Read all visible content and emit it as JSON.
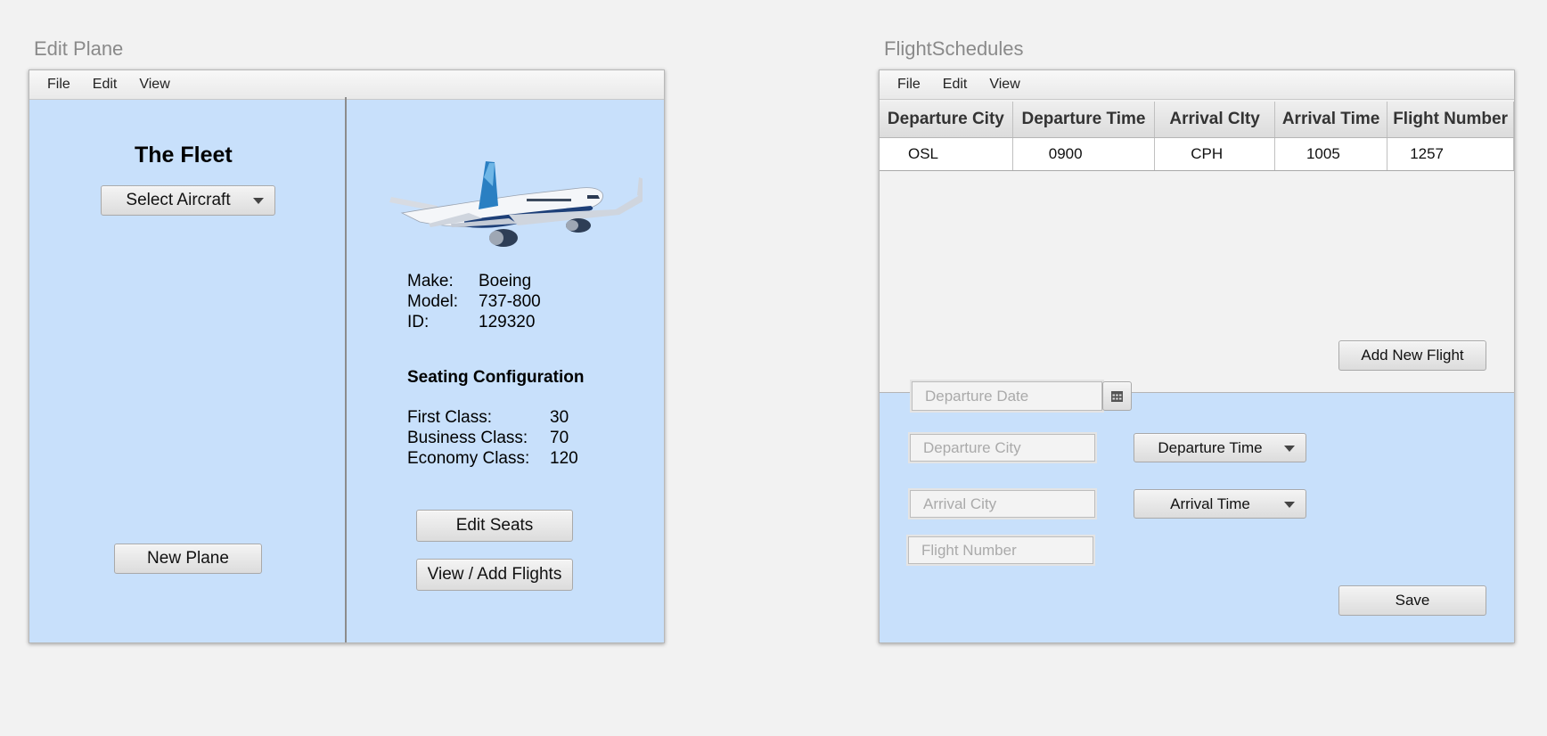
{
  "left_window": {
    "title": "Edit Plane",
    "menu": [
      "File",
      "Edit",
      "View"
    ],
    "fleet_title": "The Fleet",
    "select_aircraft_label": "Select Aircraft",
    "new_plane_label": "New Plane",
    "details": {
      "make_label": "Make:",
      "make_value": "Boeing",
      "model_label": "Model:",
      "model_value": "737-800",
      "id_label": "ID:",
      "id_value": "129320"
    },
    "seating": {
      "title": "Seating Configuration",
      "first_label": "First Class:",
      "first_value": "30",
      "business_label": "Business Class:",
      "business_value": "70",
      "economy_label": "Economy Class:",
      "economy_value": "120"
    },
    "edit_seats_label": "Edit Seats",
    "view_add_flights_label": "View / Add Flights"
  },
  "right_window": {
    "title": "FlightSchedules",
    "menu": [
      "File",
      "Edit",
      "View"
    ],
    "table": {
      "columns": [
        "Departure City",
        "Departure Time",
        "Arrival CIty",
        "Arrival Time",
        "Flight Number"
      ],
      "rows": [
        [
          "OSL",
          "0900",
          "CPH",
          "1005",
          "1257"
        ]
      ]
    },
    "add_new_flight_label": "Add New Flight",
    "departure_date_placeholder": "Departure Date",
    "departure_city_placeholder": "Departure City",
    "departure_time_label": "Departure Time",
    "arrival_city_placeholder": "Arrival City",
    "arrival_time_label": "Arrival Time",
    "flight_number_placeholder": "Flight Number",
    "save_label": "Save"
  },
  "colors": {
    "panel_bg": "#c8e0fb",
    "page_bg": "#f2f2f2",
    "plane_livery": "#1d3f78"
  },
  "icons": [
    "calendar-icon",
    "chevron-down-icon",
    "airplane-image"
  ]
}
